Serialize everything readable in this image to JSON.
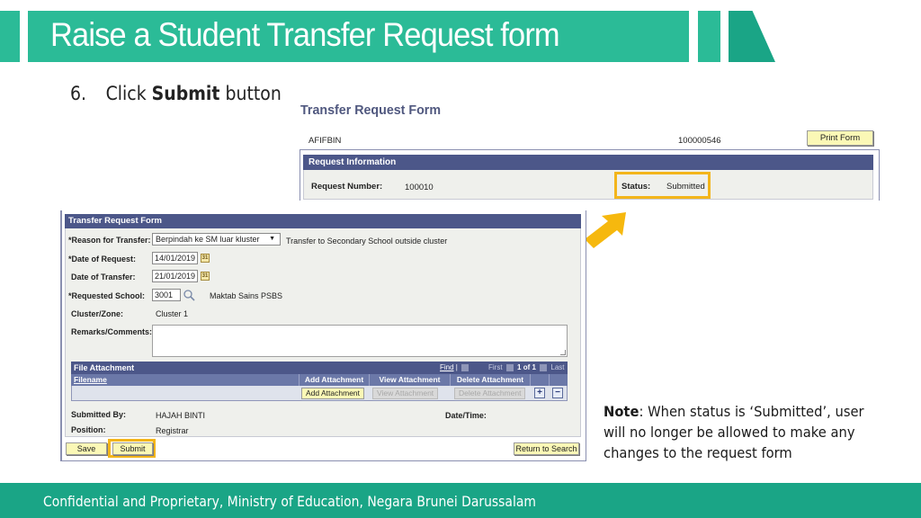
{
  "slide": {
    "title": "Raise a Student Transfer Request form",
    "step_number": "6.",
    "step_prefix": "Click ",
    "step_bold": "Submit",
    "step_suffix": " button",
    "note_bold": "Note",
    "note_text": ": When status is ‘Submitted’, user will no longer be allowed to make any changes to the request form",
    "footer": "Confidential and Proprietary, Ministry of Education, Negara Brunei Darussalam",
    "colors": {
      "header_teal": "#2bbb97",
      "footer_teal": "#1aa586",
      "highlight": "#f3b51b"
    }
  },
  "status_screen": {
    "title": "Transfer Request Form",
    "user_id": "AFIFBIN",
    "employee_id": "100000546",
    "print_button": "Print Form",
    "section_title": "Request Information",
    "request_number_label": "Request Number:",
    "request_number": "100010",
    "status_label": "Status:",
    "status": "Submitted"
  },
  "form": {
    "section_title": "Transfer Request Form",
    "reason_label": "*Reason for Transfer:",
    "reason_value": "Berpindah ke SM luar kluster",
    "reason_description": "Transfer to Secondary School outside cluster",
    "date_request_label": "*Date of Request:",
    "date_request_value": "14/01/2019",
    "date_transfer_label": "Date of Transfer:",
    "date_transfer_value": "21/01/2019",
    "school_label": "*Requested School:",
    "school_code": "3001",
    "school_name": "Maktab Sains PSBS",
    "cluster_label": "Cluster/Zone:",
    "cluster_value": "Cluster 1",
    "remarks_label": "Remarks/Comments:",
    "remarks_value": "",
    "calendar_glyph": "31",
    "file_attachment": {
      "title": "File Attachment",
      "find": "Find",
      "first": "First",
      "page": "1 of 1",
      "last": "Last",
      "columns": [
        "Filename",
        "Add Attachment",
        "View Attachment",
        "Delete Attachment"
      ],
      "add_button": "Add Attachment",
      "view_button": "View Attachment",
      "delete_button": "Delete Attachment",
      "add_row": "+",
      "delete_row": "−"
    },
    "submitted_by_label": "Submitted By:",
    "submitted_by_value": "HAJAH BINTI",
    "datetime_label": "Date/Time:",
    "position_label": "Position:",
    "position_value": "Registrar",
    "save_button": "Save",
    "submit_button": "Submit",
    "return_button": "Return to Search"
  }
}
